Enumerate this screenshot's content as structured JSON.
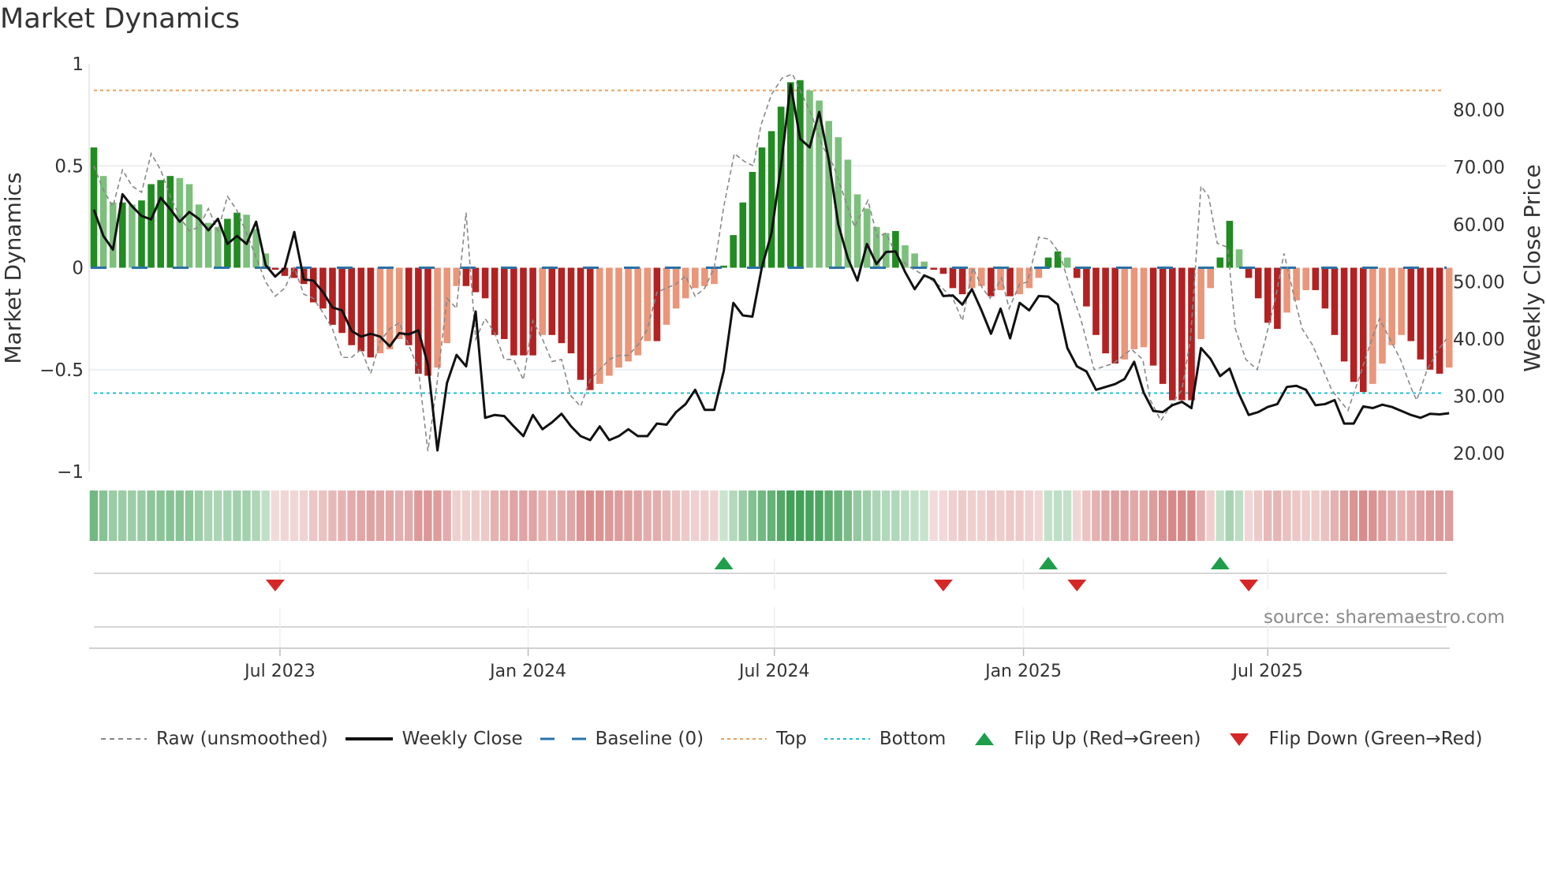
{
  "title": "Market Dynamics",
  "source": "source: sharemaestro.com",
  "legend": [
    {
      "key": "raw",
      "label": "Raw (unsmoothed)"
    },
    {
      "key": "close",
      "label": "Weekly Close"
    },
    {
      "key": "baseline",
      "label": "Baseline (0)"
    },
    {
      "key": "top",
      "label": "Top"
    },
    {
      "key": "bottom",
      "label": "Bottom"
    },
    {
      "key": "flip_up",
      "label": "Flip Up (Red→Green)"
    },
    {
      "key": "flip_down",
      "label": "Flip Down (Green→Red)"
    }
  ],
  "colors": {
    "pos_strong": "#228b22",
    "pos_weak": "#7dbf7d",
    "neg_strong": "#b22222",
    "neg_weak": "#e9967a",
    "raw": "#888888",
    "close": "#111111",
    "baseline": "#2a72a8",
    "top": "#e8a060",
    "bottom": "#1fbfd6",
    "flip_up": "#1e9e4a",
    "flip_down": "#d62728"
  },
  "chart_data": {
    "type": "bar",
    "title": "Market Dynamics",
    "x_unit": "week index",
    "x_ticks": [
      {
        "label": "Jul 2023",
        "week": 19.5
      },
      {
        "label": "Jan 2024",
        "week": 45.5
      },
      {
        "label": "Jul 2024",
        "week": 71.3
      },
      {
        "label": "Jan 2025",
        "week": 97.4
      },
      {
        "label": "Jul 2025",
        "week": 123
      }
    ],
    "left_axis": {
      "label": "Market Dynamics",
      "ylim": [
        -1,
        1
      ],
      "ticks": [
        {
          "v": 1,
          "label": "1"
        },
        {
          "v": 0.5,
          "label": "0.5"
        },
        {
          "v": 0,
          "label": "0"
        },
        {
          "v": -0.5,
          "label": "−0.5"
        },
        {
          "v": -1,
          "label": "−1"
        }
      ]
    },
    "right_axis": {
      "label": "Weekly Close Price",
      "ylim": [
        16.8,
        88.1
      ],
      "ticks": [
        {
          "v": 80,
          "label": "80.00"
        },
        {
          "v": 70,
          "label": "70.00"
        },
        {
          "v": 60,
          "label": "60.00"
        },
        {
          "v": 50,
          "label": "50.00"
        },
        {
          "v": 40,
          "label": "40.00"
        },
        {
          "v": 30,
          "label": "30.00"
        },
        {
          "v": 20,
          "label": "20.00"
        }
      ]
    },
    "top": 0.87,
    "bottom": -0.615,
    "baseline": 0,
    "momentum": [
      0.59,
      0.45,
      0.32,
      0.32,
      0.31,
      0.33,
      0.41,
      0.43,
      0.45,
      0.44,
      0.41,
      0.31,
      0.22,
      0.2,
      0.24,
      0.27,
      0.26,
      0.19,
      0.07,
      -0.01,
      -0.04,
      -0.05,
      -0.08,
      -0.17,
      -0.2,
      -0.28,
      -0.32,
      -0.38,
      -0.41,
      -0.44,
      -0.42,
      -0.4,
      -0.35,
      -0.38,
      -0.52,
      -0.53,
      -0.49,
      -0.37,
      -0.09,
      -0.09,
      -0.12,
      -0.15,
      -0.33,
      -0.35,
      -0.43,
      -0.43,
      -0.43,
      -0.33,
      -0.33,
      -0.37,
      -0.42,
      -0.55,
      -0.6,
      -0.57,
      -0.53,
      -0.49,
      -0.46,
      -0.43,
      -0.36,
      -0.36,
      -0.28,
      -0.2,
      -0.15,
      -0.1,
      -0.09,
      -0.08,
      0.01,
      0.16,
      0.32,
      0.47,
      0.59,
      0.67,
      0.79,
      0.91,
      0.92,
      0.87,
      0.82,
      0.72,
      0.64,
      0.53,
      0.36,
      0.29,
      0.2,
      0.17,
      0.18,
      0.11,
      0.07,
      0.03,
      -0.01,
      -0.03,
      -0.1,
      -0.13,
      -0.1,
      -0.09,
      -0.14,
      -0.11,
      -0.14,
      -0.13,
      -0.1,
      -0.05,
      0.05,
      0.08,
      0.05,
      -0.05,
      -0.19,
      -0.33,
      -0.42,
      -0.47,
      -0.45,
      -0.4,
      -0.39,
      -0.48,
      -0.57,
      -0.65,
      -0.65,
      -0.65,
      -0.35,
      -0.1,
      0.05,
      0.23,
      0.09,
      -0.05,
      -0.15,
      -0.27,
      -0.3,
      -0.22,
      -0.16,
      -0.11,
      -0.11,
      -0.2,
      -0.33,
      -0.46,
      -0.56,
      -0.61,
      -0.57,
      -0.47,
      -0.38,
      -0.33,
      -0.36,
      -0.45,
      -0.5,
      -0.52,
      -0.49
    ],
    "raw": [
      [
        0,
        0.5
      ],
      [
        1,
        0.38
      ],
      [
        2,
        0.3
      ],
      [
        3,
        0.48
      ],
      [
        4,
        0.4
      ],
      [
        5,
        0.37
      ],
      [
        6,
        0.56
      ],
      [
        7,
        0.48
      ],
      [
        8,
        0.35
      ],
      [
        9,
        0.25
      ],
      [
        10,
        0.18
      ],
      [
        11,
        0.2
      ],
      [
        12,
        0.29
      ],
      [
        13,
        0.18
      ],
      [
        14,
        0.35
      ],
      [
        15,
        0.28
      ],
      [
        16,
        0.17
      ],
      [
        17,
        0.05
      ],
      [
        18,
        -0.07
      ],
      [
        19,
        -0.14
      ],
      [
        20,
        -0.1
      ],
      [
        21,
        0.0
      ],
      [
        22,
        -0.13
      ],
      [
        23,
        -0.15
      ],
      [
        24,
        -0.22
      ],
      [
        25,
        -0.3
      ],
      [
        26,
        -0.44
      ],
      [
        27,
        -0.44
      ],
      [
        28,
        -0.4
      ],
      [
        29,
        -0.52
      ],
      [
        30,
        -0.36
      ],
      [
        31,
        -0.3
      ],
      [
        32,
        -0.27
      ],
      [
        33,
        -0.38
      ],
      [
        34,
        -0.5
      ],
      [
        35,
        -0.9
      ],
      [
        36,
        -0.55
      ],
      [
        37,
        -0.15
      ],
      [
        38,
        -0.2
      ],
      [
        39,
        0.27
      ],
      [
        40,
        -0.35
      ],
      [
        41,
        -0.25
      ],
      [
        42,
        -0.32
      ],
      [
        43,
        -0.45
      ],
      [
        44,
        -0.45
      ],
      [
        45,
        -0.55
      ],
      [
        46,
        -0.26
      ],
      [
        47,
        -0.35
      ],
      [
        48,
        -0.46
      ],
      [
        49,
        -0.45
      ],
      [
        50,
        -0.63
      ],
      [
        51,
        -0.68
      ],
      [
        52,
        -0.55
      ],
      [
        53,
        -0.5
      ],
      [
        54,
        -0.45
      ],
      [
        55,
        -0.43
      ],
      [
        56,
        -0.43
      ],
      [
        57,
        -0.38
      ],
      [
        58,
        -0.3
      ],
      [
        59,
        -0.12
      ],
      [
        60,
        -0.1
      ],
      [
        61,
        -0.08
      ],
      [
        62,
        -0.04
      ],
      [
        63,
        -0.14
      ],
      [
        64,
        -0.1
      ],
      [
        65,
        0.0
      ],
      [
        66,
        0.3
      ],
      [
        67.1,
        0.56
      ],
      [
        68.2,
        0.52
      ],
      [
        69.1,
        0.5
      ],
      [
        69.9,
        0.7
      ],
      [
        71.0,
        0.85
      ],
      [
        72.1,
        0.93
      ],
      [
        73.2,
        0.95
      ],
      [
        74.2,
        0.85
      ],
      [
        75.2,
        0.75
      ],
      [
        76.3,
        0.6
      ],
      [
        77.5,
        0.5
      ],
      [
        78.6,
        0.35
      ],
      [
        79.7,
        0.2
      ],
      [
        81.1,
        0.33
      ],
      [
        82.1,
        0.15
      ],
      [
        83.0,
        0.17
      ],
      [
        84.2,
        0.05
      ],
      [
        85.6,
        0.0
      ],
      [
        86.7,
        -0.03
      ],
      [
        87.8,
        -0.06
      ],
      [
        88.9,
        -0.1
      ],
      [
        90.0,
        -0.15
      ],
      [
        91.0,
        -0.26
      ],
      [
        92.1,
        0.0
      ],
      [
        93.1,
        -0.1
      ],
      [
        93.9,
        -0.15
      ],
      [
        95.1,
        -0.05
      ],
      [
        95.9,
        -0.2
      ],
      [
        97.0,
        -0.08
      ],
      [
        97.8,
        -0.07
      ],
      [
        99.0,
        0.15
      ],
      [
        100.1,
        0.14
      ],
      [
        101.2,
        0.07
      ],
      [
        102.3,
        -0.1
      ],
      [
        103.4,
        -0.25
      ],
      [
        104.8,
        -0.5
      ],
      [
        106.8,
        -0.47
      ],
      [
        108.7,
        -0.4
      ],
      [
        109.9,
        -0.45
      ],
      [
        110.7,
        -0.65
      ],
      [
        111.8,
        -0.75
      ],
      [
        112.9,
        -0.67
      ],
      [
        114.0,
        -0.6
      ],
      [
        114.9,
        -0.35
      ],
      [
        116.0,
        0.4
      ],
      [
        116.8,
        0.35
      ],
      [
        117.7,
        0.12
      ],
      [
        118.8,
        0.1
      ],
      [
        119.6,
        -0.3
      ],
      [
        120.7,
        -0.45
      ],
      [
        121.9,
        -0.5
      ],
      [
        122.7,
        -0.36
      ],
      [
        123.8,
        -0.15
      ],
      [
        124.7,
        0.07
      ],
      [
        125.8,
        -0.15
      ],
      [
        126.6,
        -0.3
      ],
      [
        127.7,
        -0.38
      ],
      [
        128.8,
        -0.5
      ],
      [
        129.7,
        -0.6
      ],
      [
        131.4,
        -0.7
      ],
      [
        132.5,
        -0.55
      ],
      [
        133.9,
        -0.35
      ],
      [
        134.7,
        -0.25
      ],
      [
        135.8,
        -0.35
      ],
      [
        136.9,
        -0.45
      ],
      [
        138.1,
        -0.6
      ],
      [
        138.6,
        -0.65
      ],
      [
        139.7,
        -0.5
      ],
      [
        140.9,
        -0.4
      ],
      [
        141.7,
        -0.35
      ]
    ],
    "close": [
      62.6,
      58.0,
      55.6,
      65.3,
      63.2,
      61.5,
      60.9,
      64.7,
      62.7,
      60.5,
      62.2,
      61.0,
      59.0,
      61.0,
      56.6,
      58.0,
      56.6,
      60.5,
      52.9,
      50.9,
      52.4,
      58.7,
      50.4,
      50.2,
      48.2,
      45.5,
      45.0,
      41.4,
      40.4,
      40.9,
      40.4,
      38.7,
      41.0,
      40.8,
      41.5,
      35.5,
      20.5,
      32.3,
      37.2,
      35.2,
      44.8,
      26.2,
      26.7,
      26.5,
      24.7,
      23.0,
      26.7,
      24.2,
      25.4,
      26.9,
      24.7,
      23.0,
      22.3,
      24.7,
      22.3,
      23.0,
      24.2,
      23.0,
      23.0,
      25.2,
      25.0,
      27.2,
      28.6,
      31.1,
      27.6,
      27.6,
      34.4,
      46.3,
      44.1,
      43.9,
      52.6,
      58.5,
      70.3,
      84.5,
      75.0,
      73.5,
      79.7,
      71.3,
      60.0,
      54.1,
      50.2,
      56.6,
      53.1,
      55.2,
      55.3,
      51.7,
      48.7,
      51.1,
      50.4,
      47.5,
      47.6,
      46.0,
      48.7,
      45.0,
      40.9,
      45.3,
      40.1,
      46.3,
      45.0,
      47.5,
      47.4,
      46.0,
      38.4,
      35.2,
      34.3,
      31.1,
      31.6,
      32.1,
      33.0,
      36.0,
      30.6,
      27.4,
      27.2,
      28.4,
      29.0,
      27.9,
      38.4,
      36.5,
      33.5,
      34.8,
      30.3,
      26.7,
      27.2,
      28.1,
      28.6,
      31.6,
      31.8,
      31.1,
      28.4,
      28.6,
      29.3,
      25.2,
      25.2,
      28.2,
      27.9,
      28.5,
      28.1,
      27.4,
      26.7,
      26.2,
      26.9,
      26.8,
      27.0
    ],
    "flips_up": [
      66,
      100,
      118
    ],
    "flips_down": [
      19,
      89,
      103,
      121
    ]
  }
}
